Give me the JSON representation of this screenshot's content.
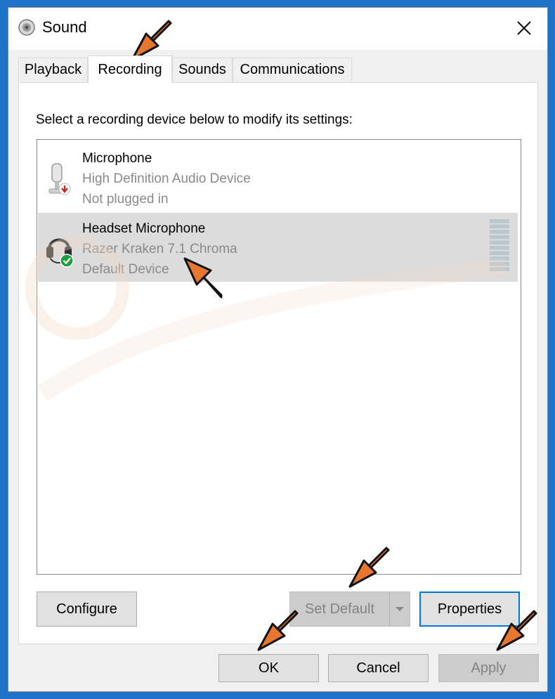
{
  "window": {
    "title": "Sound"
  },
  "tabs": [
    {
      "label": "Playback",
      "active": false
    },
    {
      "label": "Recording",
      "active": true
    },
    {
      "label": "Sounds",
      "active": false
    },
    {
      "label": "Communications",
      "active": false
    }
  ],
  "instruction": "Select a recording device below to modify its settings:",
  "devices": [
    {
      "name": "Microphone",
      "description": "High Definition Audio Device",
      "status": "Not plugged in",
      "icon": "microphone-unplugged-icon",
      "selected": false
    },
    {
      "name": "Headset Microphone",
      "description": "Razer Kraken 7.1 Chroma",
      "status": "Default Device",
      "icon": "headset-default-icon",
      "selected": true
    }
  ],
  "buttons": {
    "configure": "Configure",
    "set_default": "Set Default",
    "properties": "Properties",
    "ok": "OK",
    "cancel": "Cancel",
    "apply": "Apply"
  },
  "colors": {
    "accent": "#0078d7",
    "annotation_arrow": "#e8772e",
    "default_check": "#1e9e3a",
    "unplugged_badge": "#c42b1c"
  }
}
